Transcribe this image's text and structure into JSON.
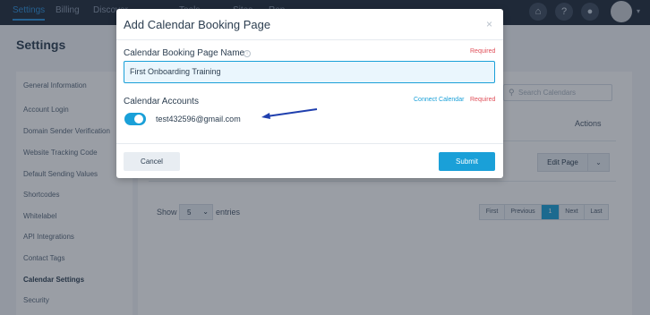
{
  "topnav": {
    "tabs": [
      "Settings",
      "Billing",
      "Discover",
      "Tools",
      "Sites",
      "Rep"
    ]
  },
  "page": {
    "title": "Settings"
  },
  "sidebar": {
    "items": [
      {
        "label": "General Information"
      },
      {
        "label": "Account Login"
      },
      {
        "label": "Domain Sender Verification"
      },
      {
        "label": "Website Tracking Code"
      },
      {
        "label": "Default Sending Values"
      },
      {
        "label": "Shortcodes"
      },
      {
        "label": "Whitelabel"
      },
      {
        "label": "API Integrations"
      },
      {
        "label": "Contact Tags"
      },
      {
        "label": "Calendar Settings",
        "active": true
      },
      {
        "label": "Security"
      }
    ]
  },
  "main": {
    "search_placeholder": "Search Calendars",
    "actions_header": "Actions",
    "edit_page_label": "Edit Page",
    "show_label": "Show",
    "show_value": "5",
    "entries_label": "entries",
    "pagination": {
      "first": "First",
      "previous": "Previous",
      "current": "1",
      "next": "Next",
      "last": "Last"
    }
  },
  "modal": {
    "title": "Add Calendar Booking Page",
    "close_glyph": "×",
    "name_label": "Calendar Booking Page Name",
    "required_text": "Required",
    "name_value": "First Onboarding Training",
    "accounts_label": "Calendar Accounts",
    "connect_link": "Connect Calendar",
    "account_email": "test432596@gmail.com",
    "account_enabled": true,
    "cancel_label": "Cancel",
    "submit_label": "Submit"
  },
  "colors": {
    "accent": "#1aa0d8",
    "required": "#e0505a",
    "arrow": "#1f3fae",
    "topbar": "#1f2a3a"
  }
}
